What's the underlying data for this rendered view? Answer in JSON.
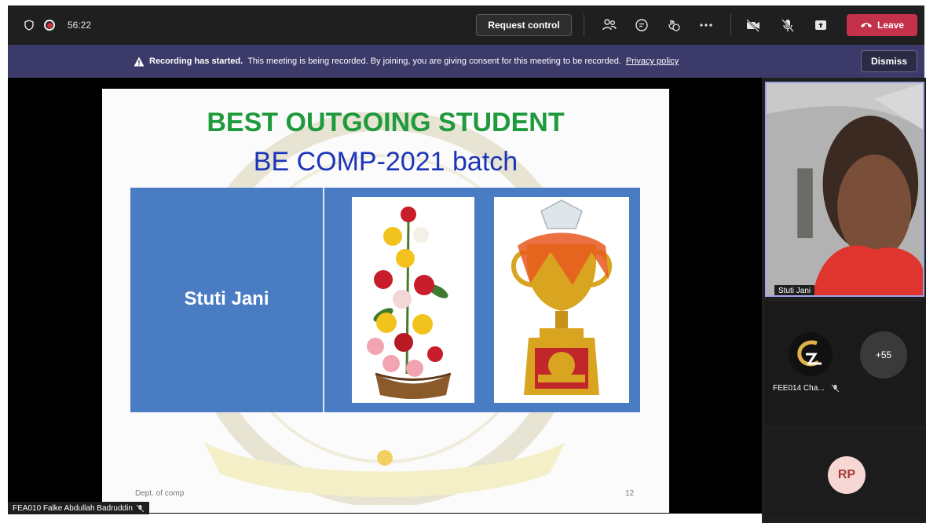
{
  "topbar": {
    "timer": "56:22",
    "request_control_label": "Request control",
    "leave_label": "Leave",
    "icons": [
      "shield-icon",
      "record-icon",
      "participants-icon",
      "chat-icon",
      "reactions-icon",
      "more-icon",
      "camera-off-icon",
      "mic-off-icon",
      "share-icon",
      "phone-icon"
    ]
  },
  "banner": {
    "bold": "Recording has started.",
    "message": "This meeting is being recorded. By joining, you are giving consent for this meeting to be recorded.",
    "link": "Privacy policy",
    "dismiss_label": "Dismiss"
  },
  "slide": {
    "title": "BEST OUTGOING STUDENT",
    "subtitle": "BE COMP-2021 batch",
    "student_name": "Stuti Jani",
    "footer": "Dept. of comp",
    "page_number": "12",
    "colors": {
      "title": "#1f9a3c",
      "subtitle": "#1c35b8",
      "box": "#4a7cc4"
    }
  },
  "presenter": {
    "name": "FEA010 Falke Abdullah Badruddin"
  },
  "participants": {
    "video_tile_name": "Stuti Jani",
    "tile2_name": "FEE014 Cha...",
    "overflow_count": "+55",
    "rp_initials": "RP"
  }
}
